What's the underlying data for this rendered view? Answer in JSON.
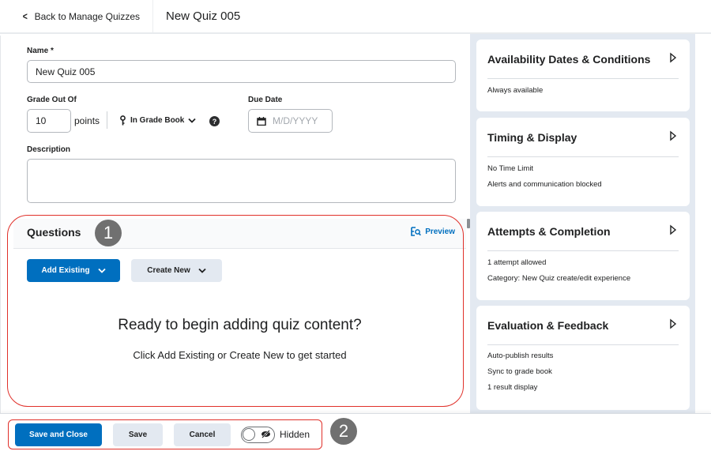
{
  "topbar": {
    "back_label": "Back to Manage Quizzes",
    "page_title": "New Quiz 005"
  },
  "form": {
    "name_label": "Name *",
    "name_value": "New Quiz 005",
    "grade_label": "Grade Out Of",
    "grade_value": "10",
    "points_label": "points",
    "gradebook_label": "In Grade Book",
    "due_date_label": "Due Date",
    "due_date_placeholder": "M/D/YYYY",
    "description_label": "Description",
    "description_value": ""
  },
  "questions": {
    "title": "Questions",
    "preview_label": "Preview",
    "add_existing_label": "Add Existing",
    "create_new_label": "Create New",
    "empty_title": "Ready to begin adding quiz content?",
    "empty_subtitle": "Click Add Existing or Create New to get started"
  },
  "sidebar": {
    "cards": [
      {
        "title": "Availability Dates & Conditions",
        "lines": [
          "Always available"
        ]
      },
      {
        "title": "Timing & Display",
        "lines": [
          "No Time Limit",
          "Alerts and communication blocked"
        ]
      },
      {
        "title": "Attempts & Completion",
        "lines": [
          "1 attempt allowed",
          "Category: New Quiz create/edit experience"
        ]
      },
      {
        "title": "Evaluation & Feedback",
        "lines": [
          "Auto-publish results",
          "Sync to grade book",
          "1 result display"
        ]
      }
    ]
  },
  "footer": {
    "save_close_label": "Save and Close",
    "save_label": "Save",
    "cancel_label": "Cancel",
    "visibility_label": "Hidden",
    "visibility_on": false
  },
  "annotations": {
    "badge1": "1",
    "badge2": "2",
    "color": "#e0302a"
  },
  "colors": {
    "primary": "#006fbf",
    "secondary_button": "#e3e9f1",
    "sidebar_bg": "#e3e9f1"
  }
}
